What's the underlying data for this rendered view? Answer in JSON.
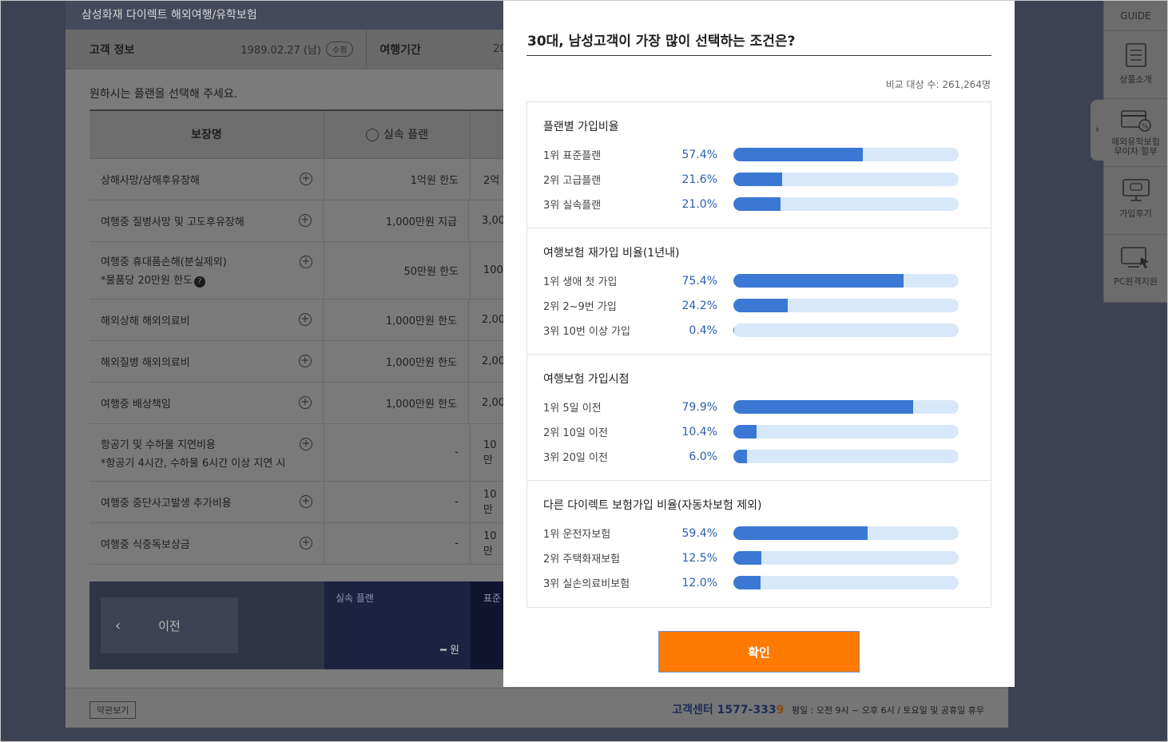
{
  "window": {
    "title": "삼성화재 다이렉트 해외여행/유학보험",
    "customer_label": "고객 정보",
    "customer_value": "1989.02.27 (남)",
    "edit_label": "수정",
    "period_label": "여행기간",
    "period_value": "20",
    "choose_text": "원하시는 플랜을 선택해 주세요.",
    "table": {
      "col_coverage": "보장명",
      "col_plan": "실속 플랜",
      "rows": [
        {
          "name": "상해사망/상해후유장해",
          "sub": "",
          "v1": "1억원 한도",
          "v2": "2억"
        },
        {
          "name": "여행중 질병사망 및 고도후유장해",
          "sub": "",
          "v1": "1,000만원 지급",
          "v2": "3,00"
        },
        {
          "name": "여행중 휴대품손해(분실제외)",
          "sub": "*물품당 20만원 한도",
          "v1": "50만원 한도",
          "v2": "100"
        },
        {
          "name": "해외상해 해외의료비",
          "sub": "",
          "v1": "1,000만원 한도",
          "v2": "2,00"
        },
        {
          "name": "해외질병 해외의료비",
          "sub": "",
          "v1": "1,000만원 한도",
          "v2": "2,00"
        },
        {
          "name": "여행중 배상책임",
          "sub": "",
          "v1": "1,000만원 한도",
          "v2": "2,00"
        },
        {
          "name": "항공기 및 수하물 지연비용",
          "sub": "*항공기 4시간, 수하물 6시간 이상 지연 시",
          "v1": "-",
          "v2": "10만"
        },
        {
          "name": "여행중 중단사고발생 추가비용",
          "sub": "",
          "v1": "-",
          "v2": "10만"
        },
        {
          "name": "여행중 식중독보상금",
          "sub": "",
          "v1": "-",
          "v2": "10만"
        }
      ]
    },
    "prev_label": "이전",
    "plan1_title": "실속 플랜",
    "plan1_price": "원",
    "plan2_title": "표준",
    "terms_label": "약관보기",
    "cs_name": "고객센터 1577-333",
    "cs_name_last": "9",
    "cs_hours": "평일 : 오전 9시 ~ 오후 6시 / 토요일 및 공휴일 휴무"
  },
  "close_icon": "close-icon",
  "guide": {
    "title": "GUIDE",
    "items": [
      {
        "label": "상품소개",
        "icon": "document-list-icon"
      },
      {
        "label": "해외유학보험\n무이자 할부",
        "icon": "card-percent-icon"
      },
      {
        "label": "가입후기",
        "icon": "monitor-chat-icon"
      },
      {
        "label": "PC원격지원",
        "icon": "monitor-cursor-icon"
      }
    ]
  },
  "modal": {
    "title": "30대, 남성고객이 가장 많이 선택하는 조건은?",
    "compare_count": "비교 대상 수: 261,264명",
    "sections": [
      {
        "title": "플랜별 가입비율",
        "rows": [
          {
            "label": "1위 표준플랜",
            "pct": "57.4%",
            "value": 57.4
          },
          {
            "label": "2위 고급플랜",
            "pct": "21.6%",
            "value": 21.6
          },
          {
            "label": "3위 실속플랜",
            "pct": "21.0%",
            "value": 21.0
          }
        ]
      },
      {
        "title": "여행보험 재가입 비율(1년내)",
        "rows": [
          {
            "label": "1위 생애 첫 가입",
            "pct": "75.4%",
            "value": 75.4
          },
          {
            "label": "2위 2~9번 가입",
            "pct": "24.2%",
            "value": 24.2
          },
          {
            "label": "3위 10번 이상 가입",
            "pct": "0.4%",
            "value": 0.4
          }
        ]
      },
      {
        "title": "여행보험 가입시점",
        "rows": [
          {
            "label": "1위 5일 이전",
            "pct": "79.9%",
            "value": 79.9
          },
          {
            "label": "2위 10일 이전",
            "pct": "10.4%",
            "value": 10.4
          },
          {
            "label": "3위 20일 이전",
            "pct": "6.0%",
            "value": 6.0
          }
        ]
      },
      {
        "title": "다른 다이렉트 보험가입 비율(자동차보험 제외)",
        "rows": [
          {
            "label": "1위 운전자보험",
            "pct": "59.4%",
            "value": 59.4
          },
          {
            "label": "2위 주택화재보험",
            "pct": "12.5%",
            "value": 12.5
          },
          {
            "label": "3위 실손의료비보험",
            "pct": "12.0%",
            "value": 12.0
          }
        ]
      }
    ],
    "confirm_label": "확인"
  },
  "colors": {
    "accent_orange": "#ff7a00",
    "bar_fill": "#3a78d4",
    "bar_track": "#d9e8f8",
    "pct_text": "#2e5db0"
  }
}
